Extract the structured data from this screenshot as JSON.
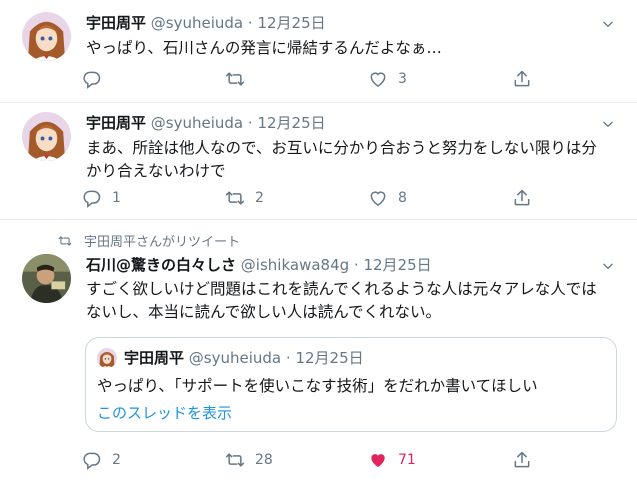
{
  "tweets": [
    {
      "name": "宇田周平",
      "handle": "@syuheiuda",
      "date": "12月25日",
      "text_lines": [
        "やっぱり、石川さんの発言に帰結するんだよなぁ…"
      ],
      "reply_count": "",
      "retweet_count": "",
      "like_count": "3"
    },
    {
      "name": "宇田周平",
      "handle": "@syuheiuda",
      "date": "12月25日",
      "text_lines": [
        "まあ、所詮は他人なので、お互いに分かり合おうと努力をしない限りは分",
        "かり合えないわけで"
      ],
      "reply_count": "1",
      "retweet_count": "2",
      "like_count": "8"
    },
    {
      "retweet_note": "宇田周平さんがリツイート",
      "name": "石川@驚きの白々しさ",
      "handle": "@ishikawa84g",
      "date": "12月25日",
      "text_lines": [
        "すごく欲しいけど問題はこれを読んでくれるような人は元々アレな人では",
        "ないし、本当に読んで欲しい人は読んでくれない。"
      ],
      "quote": {
        "name": "宇田周平",
        "handle": "@syuheiuda",
        "date": "12月25日",
        "text": "やっぱり、「サポートを使いこなす技術」をだれか書いてほしい",
        "thread_link": "このスレッドを表示"
      },
      "reply_count": "2",
      "retweet_count": "28",
      "like_count": "71",
      "liked": true
    }
  ],
  "separator": " · ",
  "colors": {
    "like_active": "#e0245e",
    "link": "#1b95e0",
    "muted": "#657786"
  },
  "icons": [
    "reply-icon",
    "retweet-icon",
    "like-icon",
    "share-icon",
    "caret-down-icon"
  ]
}
